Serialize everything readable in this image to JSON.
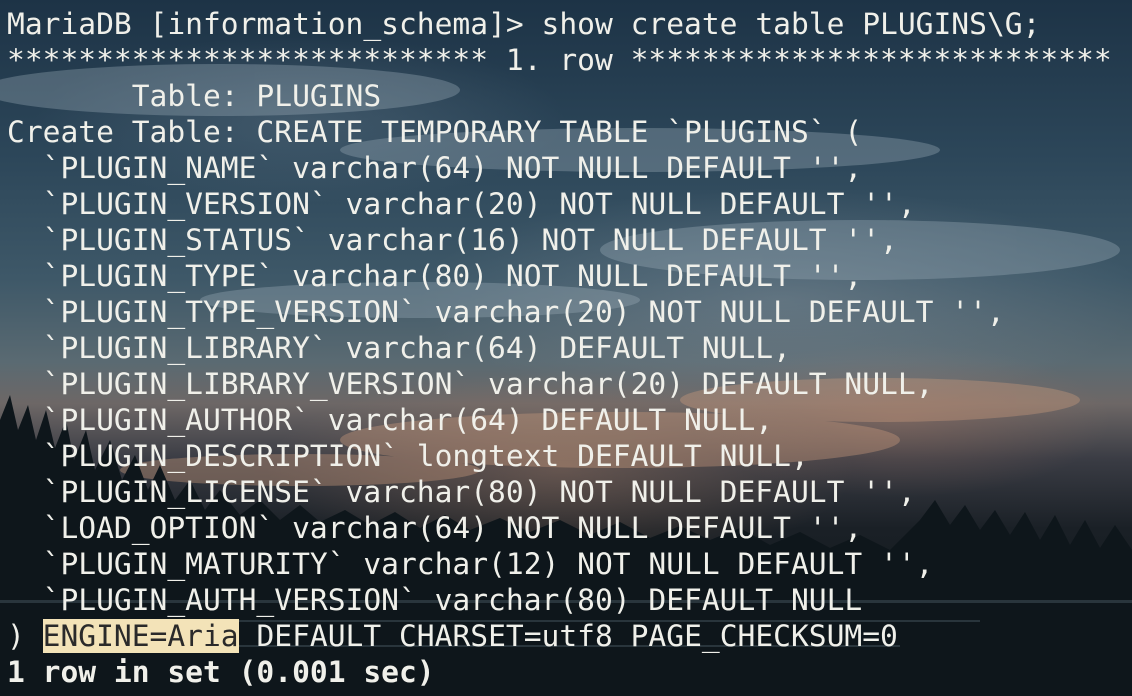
{
  "terminal": {
    "prompt": "MariaDB [information_schema]> ",
    "command": "show create table PLUGINS\\G;",
    "row_header": "*************************** 1. row ***************************",
    "table_label": "       Table: PLUGINS",
    "create_label": "Create Table: CREATE TEMPORARY TABLE `PLUGINS` (",
    "columns": [
      "  `PLUGIN_NAME` varchar(64) NOT NULL DEFAULT '',",
      "  `PLUGIN_VERSION` varchar(20) NOT NULL DEFAULT '',",
      "  `PLUGIN_STATUS` varchar(16) NOT NULL DEFAULT '',",
      "  `PLUGIN_TYPE` varchar(80) NOT NULL DEFAULT '',",
      "  `PLUGIN_TYPE_VERSION` varchar(20) NOT NULL DEFAULT '',",
      "  `PLUGIN_LIBRARY` varchar(64) DEFAULT NULL,",
      "  `PLUGIN_LIBRARY_VERSION` varchar(20) DEFAULT NULL,",
      "  `PLUGIN_AUTHOR` varchar(64) DEFAULT NULL,",
      "  `PLUGIN_DESCRIPTION` longtext DEFAULT NULL,",
      "  `PLUGIN_LICENSE` varchar(80) NOT NULL DEFAULT '',",
      "  `LOAD_OPTION` varchar(64) NOT NULL DEFAULT '',",
      "  `PLUGIN_MATURITY` varchar(12) NOT NULL DEFAULT '',",
      "  `PLUGIN_AUTH_VERSION` varchar(80) DEFAULT NULL"
    ],
    "closing_prefix": ") ",
    "engine_highlight": "ENGINE=Aria",
    "closing_suffix": " DEFAULT CHARSET=utf8 PAGE_CHECKSUM=0",
    "result_summary": "1 row in set (0.001 sec)"
  },
  "colors": {
    "text": "#f0f0ea",
    "selection_bg": "#f3e3b8",
    "selection_fg": "#2a2a2a"
  }
}
